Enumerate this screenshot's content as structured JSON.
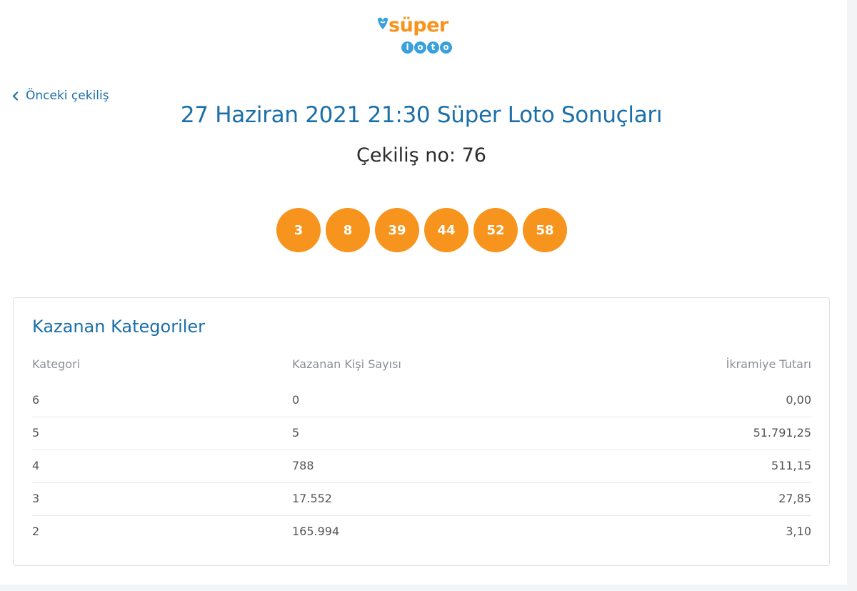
{
  "logo": {
    "brand_top": "süper",
    "brand_bottom": [
      "l",
      "o",
      "t",
      "o"
    ]
  },
  "nav": {
    "prev_label": "Önceki çekiliş"
  },
  "header": {
    "title": "27 Haziran 2021 21:30 Süper Loto Sonuçları",
    "draw_no": "Çekiliş no: 76"
  },
  "balls": [
    "3",
    "8",
    "39",
    "44",
    "52",
    "58"
  ],
  "winners": {
    "title": "Kazanan Kategoriler",
    "columns": [
      "Kategori",
      "Kazanan Kişi Sayısı",
      "İkramiye Tutarı"
    ],
    "rows": [
      {
        "category": "6",
        "winners": "0",
        "prize": "0,00"
      },
      {
        "category": "5",
        "winners": "5",
        "prize": "51.791,25"
      },
      {
        "category": "4",
        "winners": "788",
        "prize": "511,15"
      },
      {
        "category": "3",
        "winners": "17.552",
        "prize": "27,85"
      },
      {
        "category": "2",
        "winners": "165.994",
        "prize": "3,10"
      }
    ]
  },
  "colors": {
    "accent_blue": "#1b6fa8",
    "ball_orange": "#f7941d",
    "loto_blue": "#3aa0dc"
  }
}
